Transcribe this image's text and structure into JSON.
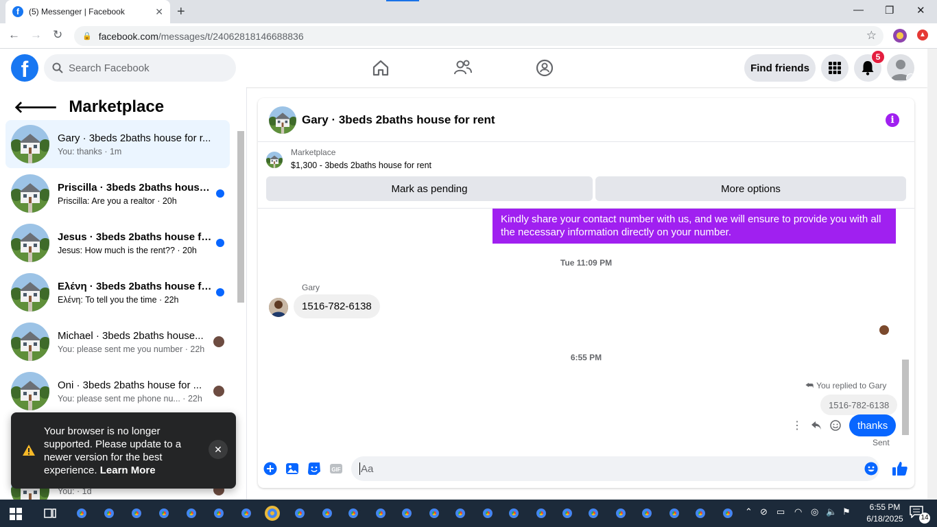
{
  "browser": {
    "tab_title": "(5) Messenger | Facebook",
    "tab_close": "✕",
    "new_tab": "+",
    "url_host": "facebook.com",
    "url_path": "/messages/t/24062818146688836"
  },
  "fb_header": {
    "search_placeholder": "Search Facebook",
    "find_friends": "Find friends",
    "notification_count": "5"
  },
  "left_panel": {
    "title": "Marketplace",
    "conversations": [
      {
        "name": "Gary · 3beds 2baths house for r...",
        "preview": "You: thanks · 1m",
        "unread": false,
        "active": true
      },
      {
        "name": "Priscilla · 3beds 2baths house ...",
        "preview": "Priscilla: Are you a realtor · 20h",
        "unread": true
      },
      {
        "name": "Jesus · 3beds 2baths house fo...",
        "preview": "Jesus: How much is the rent?? · 20h",
        "unread": true
      },
      {
        "name": "Ελένη · 3beds 2baths house fo...",
        "preview": "Ελένη: To tell you the time · 22h",
        "unread": true
      },
      {
        "name": "Michael · 3beds 2baths house...",
        "preview": "You: please sent me you number · 22h",
        "unread": false
      },
      {
        "name": "Oni · 3beds 2baths house for ...",
        "preview": "You: please sent me phone nu... · 22h",
        "unread": false
      },
      {
        "name": "",
        "preview": "You: · 1d",
        "unread": false
      }
    ]
  },
  "toast": {
    "message": "Your browser is no longer supported. Please update to a newer version for the best experience.",
    "link": "Learn More"
  },
  "chat": {
    "header_name": "Gary · 3beds 2baths house for rent",
    "marketplace_label": "Marketplace",
    "listing": "$1,300 - 3beds 2baths house for rent",
    "mark_pending": "Mark as pending",
    "more_options": "More options",
    "messages": {
      "outgoing_text": "Kindly share your contact number with us, and we will ensure to provide you with all the necessary information directly on your number.",
      "timestamp1": "Tue 11:09 PM",
      "sender_name": "Gary",
      "incoming_text": "1516-782-6138",
      "timestamp2": "6:55 PM",
      "replied_label": "You replied to Gary",
      "quoted_text": "1516-782-6138",
      "reply_text": "thanks",
      "status": "Sent"
    },
    "composer_placeholder": "Aa"
  },
  "taskbar": {
    "time": "6:55 PM",
    "date": "6/18/2025",
    "notifications": "14"
  },
  "colors": {
    "fb_blue": "#1877f2",
    "messenger_blue": "#0866ff",
    "purple_bubble": "#a020f0",
    "unread_dot": "#0866ff"
  }
}
